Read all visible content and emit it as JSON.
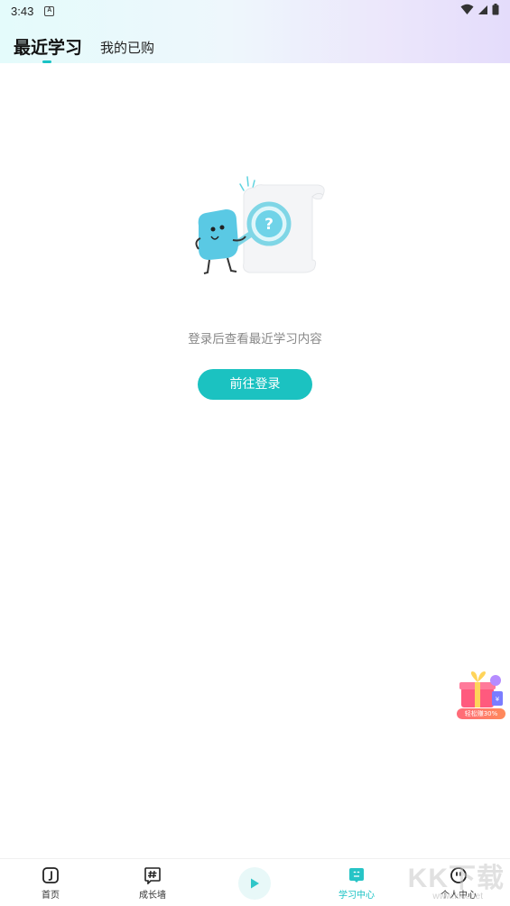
{
  "status_bar": {
    "time": "3:43",
    "a_icon_letter": "A"
  },
  "header": {
    "tabs": [
      {
        "label": "最近学习",
        "active": true
      },
      {
        "label": "我的已购",
        "active": false
      }
    ]
  },
  "empty_state": {
    "message": "登录后查看最近学习内容",
    "button_label": "前往登录"
  },
  "promo": {
    "label": "轻松赚30%"
  },
  "bottom_nav": {
    "items": [
      {
        "label": "首页",
        "icon": "home-music-icon"
      },
      {
        "label": "成长墙",
        "icon": "hashtag-icon"
      },
      {
        "label": "",
        "icon": "play-icon"
      },
      {
        "label": "学习中心",
        "icon": "study-center-icon",
        "active": true
      },
      {
        "label": "个人中心",
        "icon": "profile-icon"
      }
    ]
  },
  "watermark": {
    "main": "KK下载",
    "sub": "www.kkx.net"
  },
  "colors": {
    "accent": "#1bc2c1",
    "text_muted": "#888888"
  }
}
